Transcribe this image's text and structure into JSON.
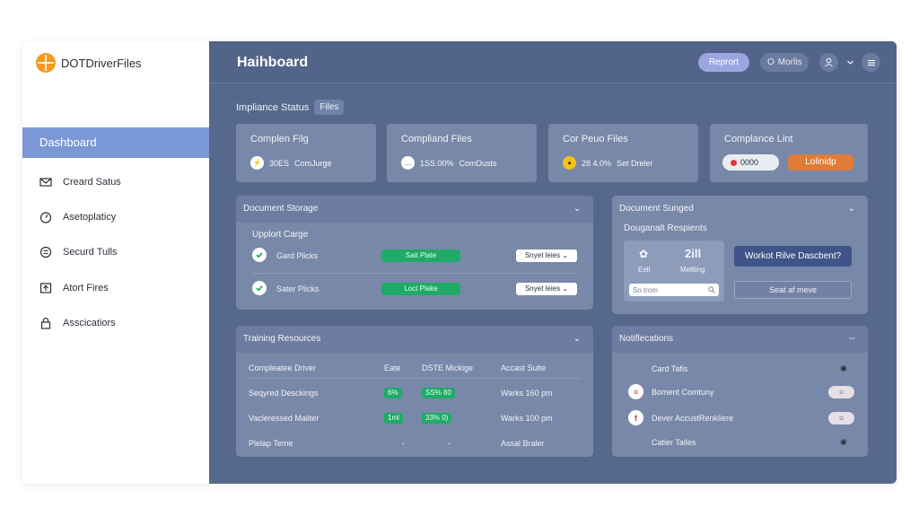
{
  "app": {
    "brand": "DOTDriverFiles"
  },
  "sidebar": {
    "active": "Dashboard",
    "items": [
      {
        "label": "Creard Satus",
        "icon": "mail-icon"
      },
      {
        "label": "Asetoplaticy",
        "icon": "gauge-icon"
      },
      {
        "label": "Securd Tulls",
        "icon": "list-icon"
      },
      {
        "label": "Atort Fires",
        "icon": "upload-icon"
      },
      {
        "label": "Asscicatiors",
        "icon": "lock-icon"
      }
    ]
  },
  "header": {
    "title": "Haihboard",
    "report_button": "Reprort",
    "user_button": "Morlis",
    "user_prefix": "O",
    "profile_icon": "user-icon",
    "chevron_icon": "chevron-down-icon",
    "menu_icon": "menu-icon"
  },
  "compliance": {
    "label": "Impliance Status",
    "chip": "Files",
    "cards": [
      {
        "title": "Complen Filg",
        "icon_glyph": "⚡",
        "value": "30ES",
        "caption": "ComJurge"
      },
      {
        "title": "Compliand Files",
        "icon_glyph": "…",
        "value": "1SS.00%",
        "caption": "ComDusts"
      },
      {
        "title": "Cor Peuo Files",
        "icon_glyph": "●",
        "value": "28 4.0%",
        "caption": "Set Dreler"
      },
      {
        "title": "Complance Lint",
        "value": "0000",
        "action": "Lolinidp"
      }
    ]
  },
  "storage": {
    "title": "Document Storage",
    "subtitle": "Upplort Carge",
    "rows": [
      {
        "label": "Gard Plicks",
        "status": "Sait Plate",
        "select": "Snyet leies"
      },
      {
        "label": "Sater Plicks",
        "status": "Loct Plake",
        "select": "Snyet leies"
      }
    ]
  },
  "signed": {
    "title": "Document Sunged",
    "subtitle": "Douganalt Respients",
    "left_label": "Eell",
    "right_value": "2ill",
    "right_label": "Mellting",
    "search_placeholder": "So trom",
    "primary_button": "Workot Rilve Dascbent?",
    "secondary_button": "Seat af meve"
  },
  "training": {
    "title": "Training Resources",
    "columns": [
      "Compleatee Driver",
      "Eate",
      "DSTE Mickige",
      "Accast Sulte"
    ],
    "rows": [
      {
        "name": "Seqyred Desckings",
        "eate": "6%",
        "mickige": "SS% 80",
        "suite": "Warks 160 pm"
      },
      {
        "name": "Vacleressed Mailter",
        "eate": "1ml",
        "mickige": "33% 0)",
        "suite": "Warks 100 pm"
      },
      {
        "name": "Plelap Teme",
        "eate": "-",
        "mickige": "-",
        "suite": "Assal Braler"
      }
    ]
  },
  "notifications": {
    "title": "Notiflecations",
    "collapse_glyph": "--",
    "items": [
      {
        "label": "Card Tafis",
        "glyph": ""
      },
      {
        "label": "Boment Comtuny",
        "glyph": "≡"
      },
      {
        "label": "Dever AccustRenkliere",
        "glyph": "f"
      },
      {
        "label": "Catier Talles",
        "glyph": ""
      }
    ]
  },
  "colors": {
    "accent": "#7b98d6",
    "main_bg": "#56698c",
    "card_bg": "#7888a9",
    "success": "#1faa66",
    "warning": "#f39a22",
    "action_orange": "#e07b38"
  }
}
